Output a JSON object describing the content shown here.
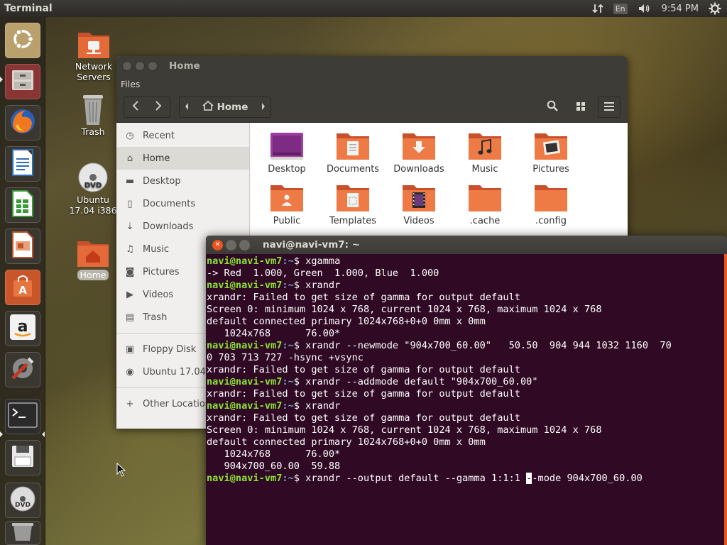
{
  "top_panel": {
    "app_title": "Terminal",
    "language": "En",
    "time": "9:54 PM",
    "icons": [
      "network-arrows-icon",
      "volume-icon",
      "gear-icon"
    ]
  },
  "launcher": {
    "items": [
      {
        "name": "ubuntu-dash",
        "icon": "ubuntu-logo-icon",
        "color": "#d2b27a"
      },
      {
        "name": "files",
        "icon": "file-cabinet-icon",
        "color": "#6b2f2f"
      },
      {
        "name": "firefox",
        "icon": "firefox-icon",
        "color": "#3a3630"
      },
      {
        "name": "writer",
        "icon": "document-icon",
        "color": "#3a3630"
      },
      {
        "name": "calc",
        "icon": "spreadsheet-icon",
        "color": "#3a3630"
      },
      {
        "name": "impress",
        "icon": "presentation-icon",
        "color": "#3a3630"
      },
      {
        "name": "software",
        "icon": "shopping-bag-icon",
        "color": "#c9552a"
      },
      {
        "name": "amazon",
        "icon": "amazon-icon",
        "color": "#3a3630"
      },
      {
        "name": "settings",
        "icon": "wrench-icon",
        "color": "#3a3630"
      },
      {
        "name": "terminal",
        "icon": "terminal-icon",
        "color": "#2c2c2c"
      },
      {
        "name": "save",
        "icon": "floppy-icon",
        "color": "#3a3630"
      },
      {
        "name": "dvd",
        "icon": "dvd-icon",
        "color": "#3a3630"
      },
      {
        "name": "trash",
        "icon": "trash-icon",
        "color": "#3a3630"
      }
    ]
  },
  "desktop_icons": [
    {
      "label_1": "Network",
      "label_2": "Servers",
      "icon": "network-folder-icon"
    },
    {
      "label_1": "Trash",
      "label_2": "",
      "icon": "trash-icon"
    },
    {
      "label_1": "Ubuntu",
      "label_2": "17.04 i386",
      "icon": "dvd-icon"
    },
    {
      "label_1": "Home",
      "label_2": "",
      "icon": "home-folder-icon"
    }
  ],
  "files": {
    "title": "Home",
    "menu": "Files",
    "location": "Home",
    "sidebar": [
      {
        "label": "Recent",
        "icon": "clock-icon"
      },
      {
        "label": "Home",
        "icon": "home-icon"
      },
      {
        "label": "Desktop",
        "icon": "folder-icon"
      },
      {
        "label": "Documents",
        "icon": "document-icon"
      },
      {
        "label": "Downloads",
        "icon": "download-icon"
      },
      {
        "label": "Music",
        "icon": "music-icon"
      },
      {
        "label": "Pictures",
        "icon": "camera-icon"
      },
      {
        "label": "Videos",
        "icon": "video-icon"
      },
      {
        "label": "Trash",
        "icon": "trash-icon"
      },
      {
        "label": "Floppy Disk",
        "icon": "floppy-icon"
      },
      {
        "label": "Ubuntu 17.04",
        "icon": "disc-icon"
      },
      {
        "label": "Other Locations",
        "icon": "plus-icon"
      }
    ],
    "folders": [
      {
        "label": "Desktop",
        "kind": "desktop"
      },
      {
        "label": "Documents",
        "kind": "documents"
      },
      {
        "label": "Downloads",
        "kind": "downloads"
      },
      {
        "label": "Music",
        "kind": "music"
      },
      {
        "label": "Pictures",
        "kind": "pictures"
      },
      {
        "label": "Public",
        "kind": "public"
      },
      {
        "label": "Templates",
        "kind": "templates"
      },
      {
        "label": "Videos",
        "kind": "videos"
      },
      {
        "label": ".cache",
        "kind": "plain"
      },
      {
        "label": ".config",
        "kind": "plain"
      }
    ]
  },
  "terminal": {
    "title": "navi@navi-vm7: ~",
    "prompt_user": "navi@navi-vm7",
    "prompt_path": ":~",
    "lines": [
      {
        "type": "prompt",
        "cmd": "$ xgamma"
      },
      {
        "type": "out",
        "text": "-> Red  1.000, Green  1.000, Blue  1.000"
      },
      {
        "type": "prompt",
        "cmd": "$ xrandr"
      },
      {
        "type": "out",
        "text": "xrandr: Failed to get size of gamma for output default"
      },
      {
        "type": "out",
        "text": "Screen 0: minimum 1024 x 768, current 1024 x 768, maximum 1024 x 768"
      },
      {
        "type": "out",
        "text": "default connected primary 1024x768+0+0 0mm x 0mm"
      },
      {
        "type": "out",
        "text": "   1024x768      76.00*"
      },
      {
        "type": "prompt",
        "cmd": "$ xrandr --newmode \"904x700_60.00\"   50.50  904 944 1032 1160  70"
      },
      {
        "type": "out",
        "text": "0 703 713 727 -hsync +vsync"
      },
      {
        "type": "out",
        "text": "xrandr: Failed to get size of gamma for output default"
      },
      {
        "type": "prompt",
        "cmd": "$ xrandr --addmode default \"904x700_60.00\""
      },
      {
        "type": "out",
        "text": "xrandr: Failed to get size of gamma for output default"
      },
      {
        "type": "prompt",
        "cmd": "$ xrandr"
      },
      {
        "type": "out",
        "text": "xrandr: Failed to get size of gamma for output default"
      },
      {
        "type": "out",
        "text": "Screen 0: minimum 1024 x 768, current 1024 x 768, maximum 1024 x 768"
      },
      {
        "type": "out",
        "text": "default connected primary 1024x768+0+0 0mm x 0mm"
      },
      {
        "type": "out",
        "text": "   1024x768      76.00*"
      },
      {
        "type": "out",
        "text": "   904x700_60.00  59.88"
      }
    ],
    "current_cmd_before": "$ xrandr --output default --gamma 1:1:1 ",
    "current_cmd_cursor": "-",
    "current_cmd_after": "-mode 904x700_60.00"
  },
  "colors": {
    "terminal_bg": "#300a24",
    "prompt_user": "#8ae234",
    "prompt_path": "#729fcf",
    "folder_orange": "#e95420"
  }
}
